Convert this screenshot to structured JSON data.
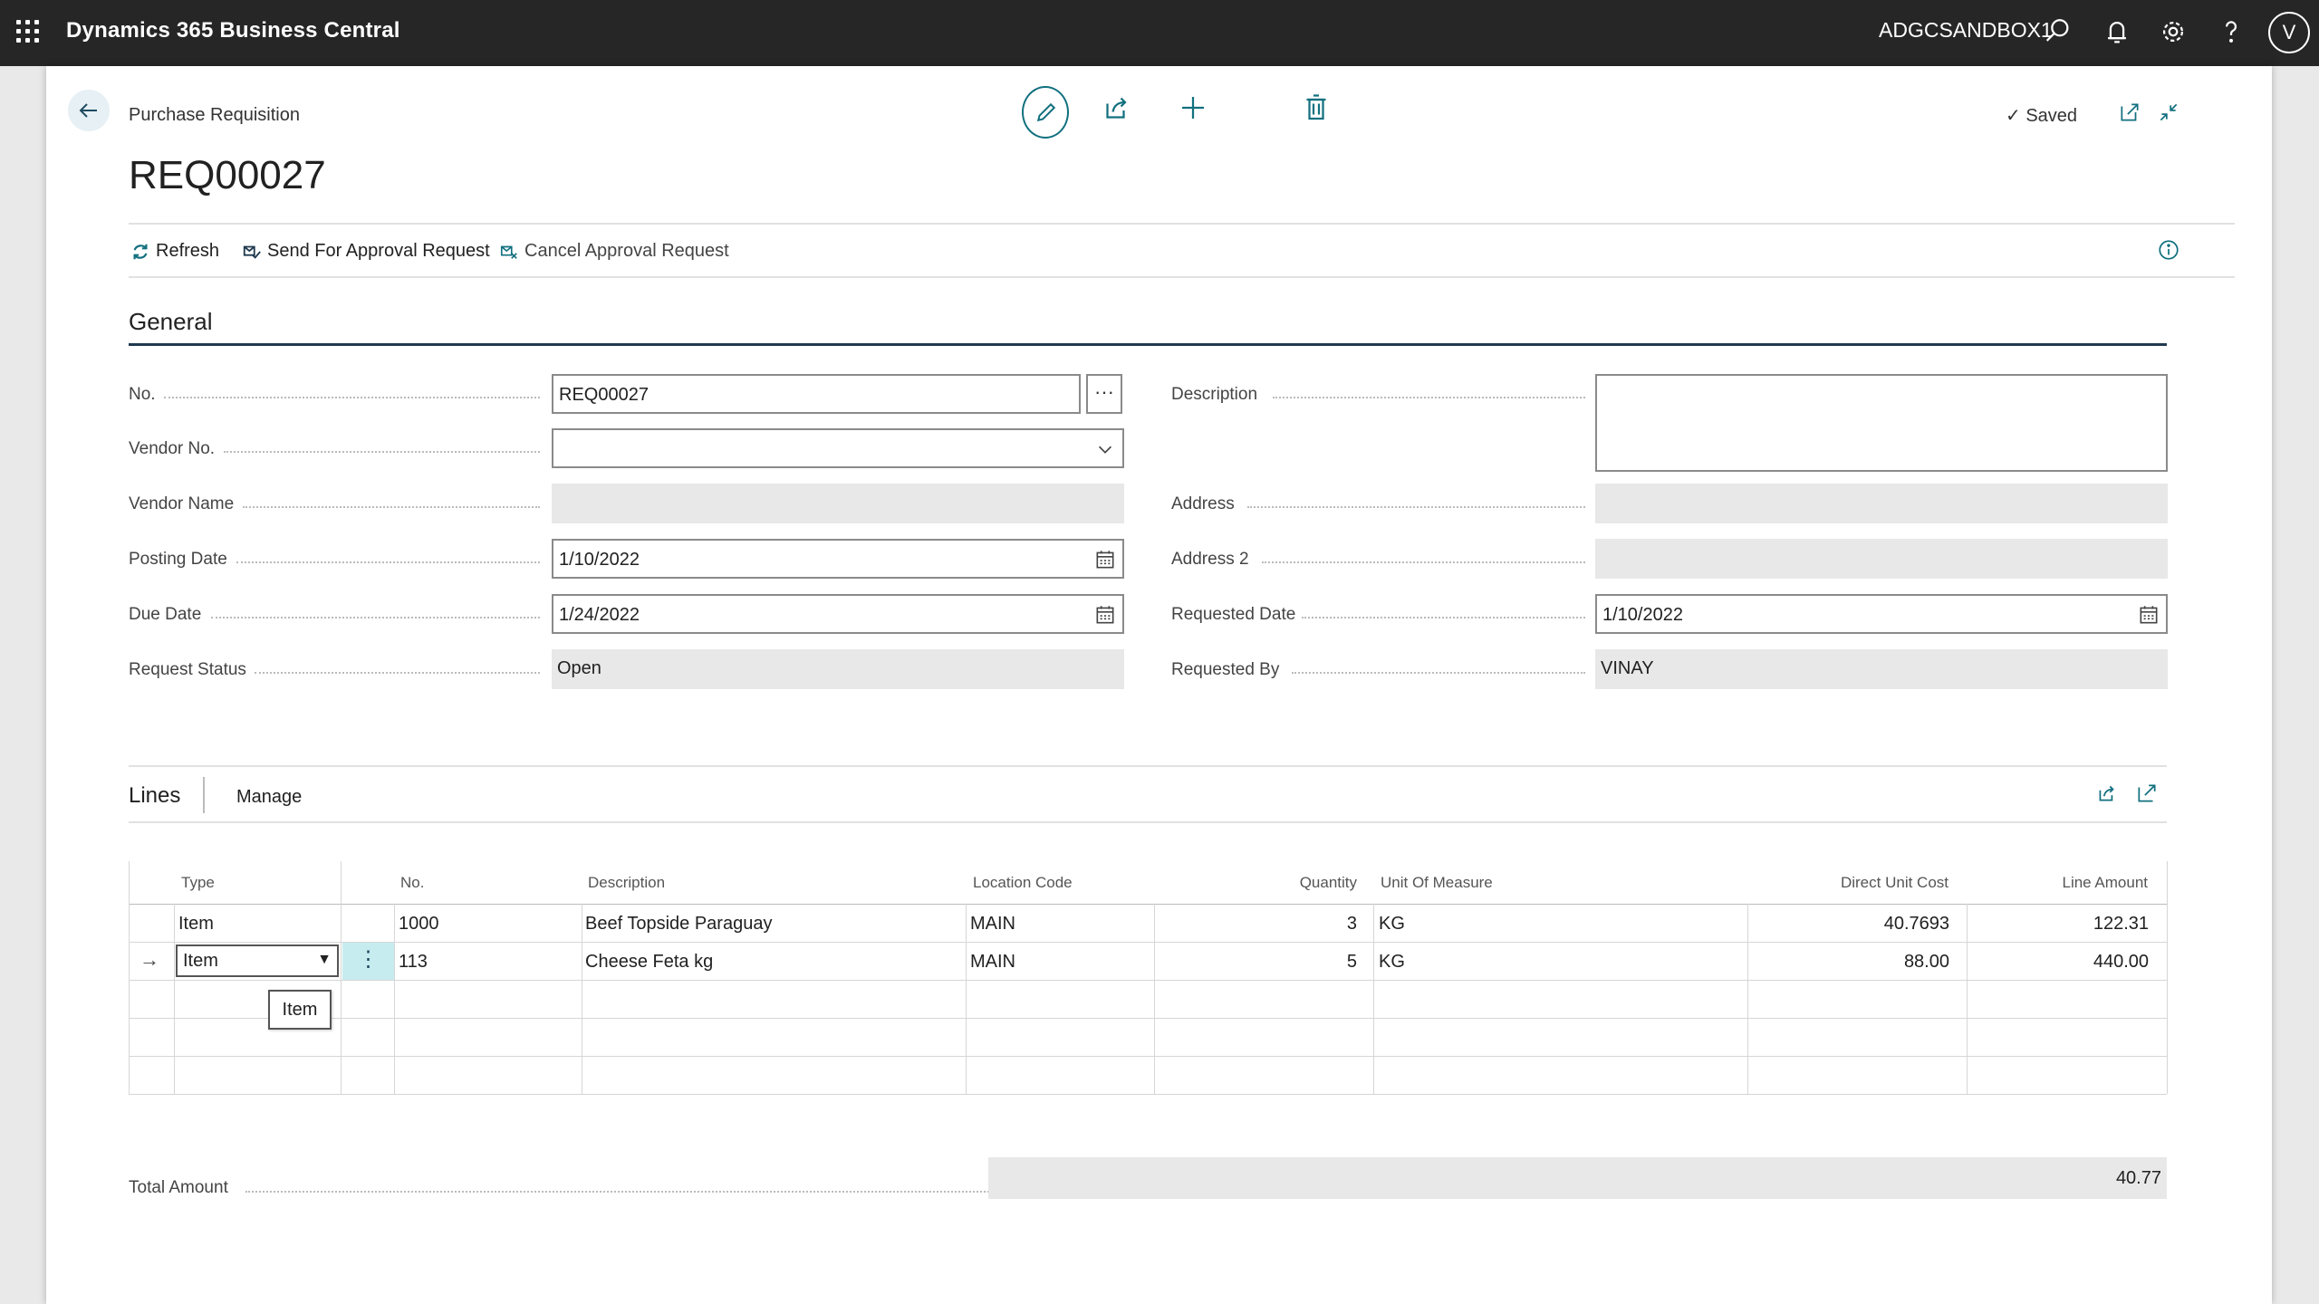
{
  "app": {
    "name": "Dynamics 365 Business Central",
    "company": "ADGCSANDBOX1",
    "user_initial": "V"
  },
  "page": {
    "breadcrumb": "Purchase Requisition",
    "title": "REQ00027",
    "saved_label": "Saved"
  },
  "actions": {
    "refresh": "Refresh",
    "send_approval": "Send For Approval Request",
    "cancel_approval": "Cancel Approval Request"
  },
  "general": {
    "title": "General",
    "no_label": "No.",
    "no_value": "REQ00027",
    "vendor_no_label": "Vendor No.",
    "vendor_no_value": "",
    "vendor_name_label": "Vendor Name",
    "vendor_name_value": "",
    "posting_date_label": "Posting Date",
    "posting_date_value": "1/10/2022",
    "due_date_label": "Due Date",
    "due_date_value": "1/24/2022",
    "request_status_label": "Request Status",
    "request_status_value": "Open",
    "description_label": "Description",
    "description_value": "",
    "address_label": "Address",
    "address_value": "",
    "address2_label": "Address 2",
    "address2_value": "",
    "requested_date_label": "Requested Date",
    "requested_date_value": "1/10/2022",
    "requested_by_label": "Requested By",
    "requested_by_value": "VINAY"
  },
  "lines": {
    "tab_lines": "Lines",
    "tab_manage": "Manage",
    "columns": {
      "type": "Type",
      "no": "No.",
      "description": "Description",
      "location": "Location Code",
      "quantity": "Quantity",
      "uom": "Unit Of Measure",
      "unit_cost": "Direct Unit Cost",
      "line_amount": "Line Amount"
    },
    "rows": [
      {
        "type": "Item",
        "no": "1000",
        "description": "Beef Topside Paraguay",
        "location": "MAIN",
        "quantity": "3",
        "uom": "KG",
        "unit_cost": "40.7693",
        "line_amount": "122.31"
      },
      {
        "type": "Item",
        "no": "113",
        "description": "Cheese Feta kg",
        "location": "MAIN",
        "quantity": "5",
        "uom": "KG",
        "unit_cost": "88.00",
        "line_amount": "440.00"
      }
    ],
    "tooltip": "Item"
  },
  "totals": {
    "label": "Total Amount",
    "value": "40.77"
  },
  "colors": {
    "accent": "#12707f",
    "topbar": "#262626"
  }
}
